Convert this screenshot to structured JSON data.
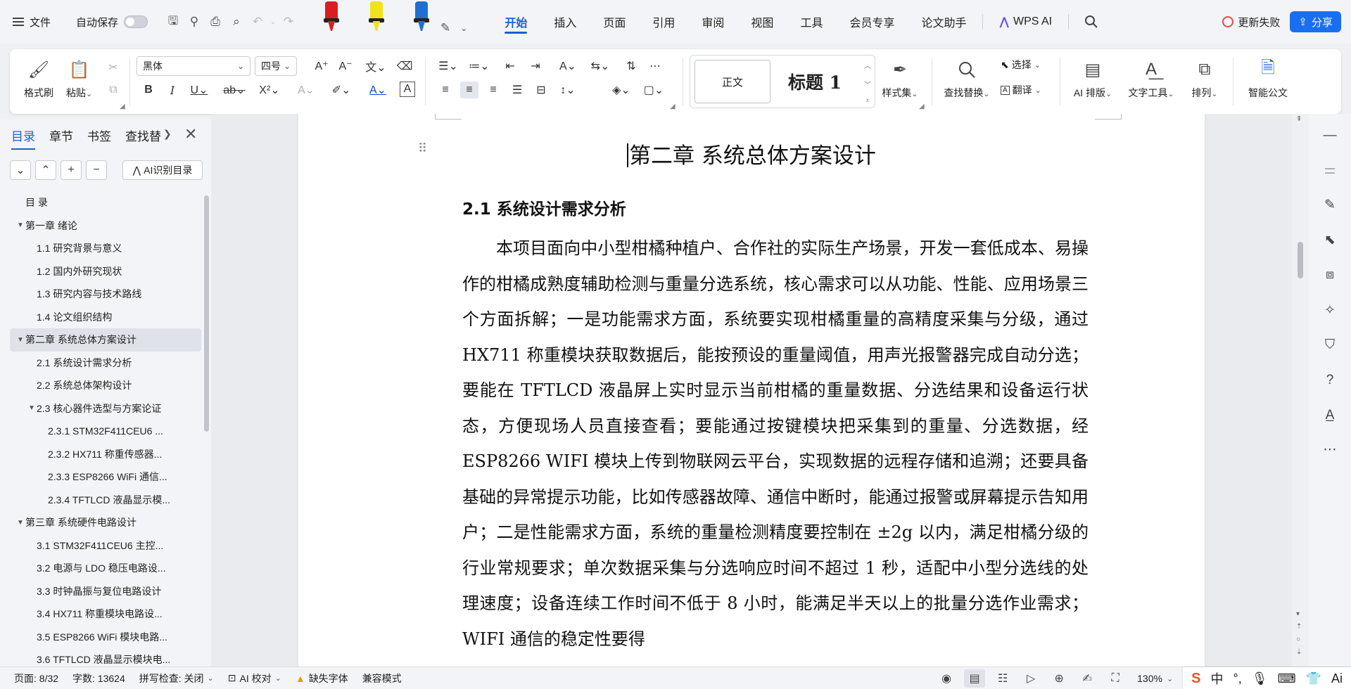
{
  "menubar": {
    "file_label": "文件",
    "autosave_label": "自动保存",
    "tabs": [
      {
        "label": "开始",
        "active": true
      },
      {
        "label": "插入"
      },
      {
        "label": "页面"
      },
      {
        "label": "引用"
      },
      {
        "label": "审阅"
      },
      {
        "label": "视图"
      },
      {
        "label": "工具"
      },
      {
        "label": "会员专享"
      },
      {
        "label": "论文助手"
      },
      {
        "label": "WPS AI"
      }
    ],
    "update_label": "更新失败",
    "share_label": "分享",
    "pen_colors": [
      "#d81e1e",
      "#f2e21b",
      "#1f6fd1"
    ]
  },
  "ribbon": {
    "format_painter": "格式刷",
    "paste": "粘贴",
    "font_name": "黑体",
    "font_size": "四号",
    "styles": {
      "normal": "正文",
      "heading1": "标题 1"
    },
    "style_set": "样式集",
    "find_replace": "查找替换",
    "select": "选择",
    "translate": "翻译",
    "ai_layout": "AI 排版",
    "text_tools": "文字工具",
    "arrange": "排列",
    "smart_formula": "智能公文"
  },
  "nav": {
    "tabs": [
      "目录",
      "章节",
      "书签",
      "查找替"
    ],
    "ai_toc_button": "AI识别目录",
    "toc": [
      {
        "level": 0,
        "text": "目 录",
        "arrow": ""
      },
      {
        "level": 0,
        "text": "第一章  绪论",
        "arrow": "▼"
      },
      {
        "level": 1,
        "text": "1.1  研究背景与意义",
        "arrow": ""
      },
      {
        "level": 1,
        "text": "1.2  国内外研究现状",
        "arrow": ""
      },
      {
        "level": 1,
        "text": "1.3  研究内容与技术路线",
        "arrow": ""
      },
      {
        "level": 1,
        "text": "1.4  论文组织结构",
        "arrow": ""
      },
      {
        "level": 0,
        "text": "第二章  系统总体方案设计",
        "arrow": "▼",
        "selected": true
      },
      {
        "level": 1,
        "text": "2.1  系统设计需求分析",
        "arrow": ""
      },
      {
        "level": 1,
        "text": "2.2  系统总体架构设计",
        "arrow": ""
      },
      {
        "level": 1,
        "text": "2.3  核心器件选型与方案论证",
        "arrow": "▼"
      },
      {
        "level": 2,
        "text": "2.3.1 STM32F411CEU6  ...",
        "arrow": ""
      },
      {
        "level": 2,
        "text": "2.3.2 HX711  称重传感器...",
        "arrow": ""
      },
      {
        "level": 2,
        "text": "2.3.3 ESP8266 WiFi  通信...",
        "arrow": ""
      },
      {
        "level": 2,
        "text": "2.3.4 TFTLCD  液晶显示模...",
        "arrow": ""
      },
      {
        "level": 0,
        "text": "第三章  系统硬件电路设计",
        "arrow": "▼"
      },
      {
        "level": 1,
        "text": "3.1 STM32F411CEU6  主控...",
        "arrow": ""
      },
      {
        "level": 1,
        "text": "3.2  电源与 LDO  稳压电路设...",
        "arrow": ""
      },
      {
        "level": 1,
        "text": "3.3  时钟晶振与复位电路设计",
        "arrow": ""
      },
      {
        "level": 1,
        "text": "3.4 HX711  称重模块电路设...",
        "arrow": ""
      },
      {
        "level": 1,
        "text": "3.5 ESP8266 WiFi  模块电路...",
        "arrow": ""
      },
      {
        "level": 1,
        "text": "3.6 TFTLCD  液晶显示模块电...",
        "arrow": ""
      }
    ]
  },
  "document": {
    "title": "第二章  系统总体方案设计",
    "heading": "2.1  系统设计需求分析",
    "body": "本项目面向中小型柑橘种植户、合作社的实际生产场景，开发一套低成本、易操作的柑橘成熟度辅助检测与重量分选系统，核心需求可以从功能、性能、应用场景三个方面拆解；一是功能需求方面，系统要实现柑橘重量的高精度采集与分级，通过 HX711 称重模块获取数据后，能按预设的重量阈值，用声光报警器完成自动分选；要能在 TFTLCD 液晶屏上实时显示当前柑橘的重量数据、分选结果和设备运行状态，方便现场人员直接查看；要能通过按键模块把采集到的重量、分选数据，经 ESP8266 WIFI 模块上传到物联网云平台，实现数据的远程存储和追溯；还要具备基础的异常提示功能，比如传感器故障、通信中断时，能通过报警或屏幕提示告知用户；二是性能需求方面，系统的重量检测精度要控制在 ±2g 以内，满足柑橘分级的行业常规要求；单次数据采集与分选响应时间不超过 1 秒，适配中小型分选线的处理速度；设备连续工作时间不低于 8 小时，能满足半天以上的批量分选作业需求；WIFI 通信的稳定性要得"
  },
  "statusbar": {
    "page": "页面: 8/32",
    "words": "字数: 13624",
    "spellcheck": "拼写检查: 关闭",
    "ai_proof": "AI 校对",
    "missing_font": "缺失字体",
    "compat_mode": "兼容模式",
    "zoom": "130%"
  },
  "ime": {
    "lang": "中"
  }
}
